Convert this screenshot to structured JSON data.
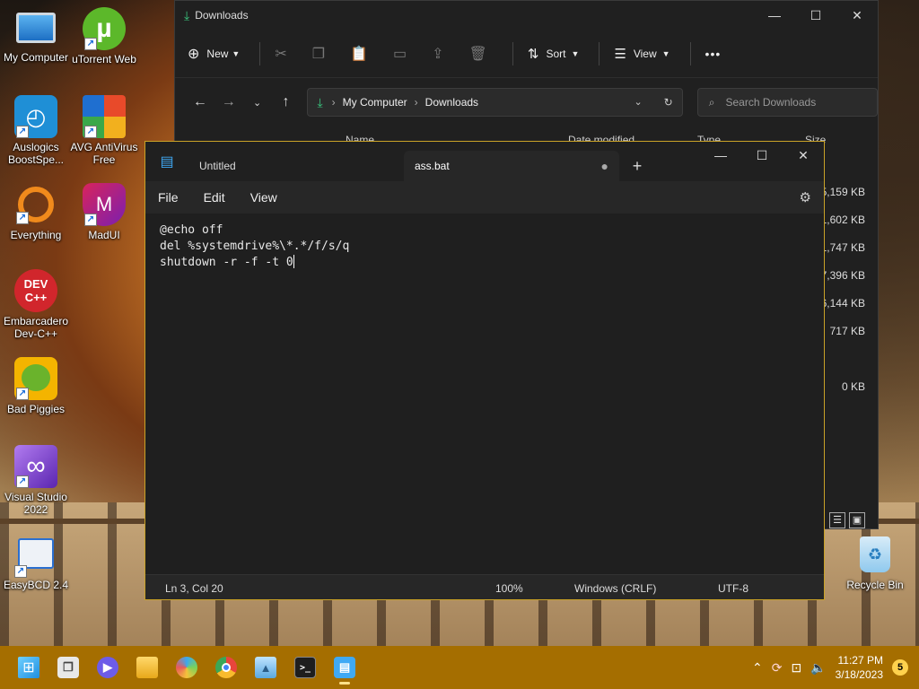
{
  "desktop_icons": [
    {
      "label": "My Computer",
      "icon": "monitor-icon",
      "color": "#2f8fe0"
    },
    {
      "label": "uTorrent Web",
      "icon": "utorrent-icon",
      "color": "#5cb82a"
    },
    {
      "label": "Auslogics BoostSpe...",
      "icon": "auslogics-icon",
      "color": "#1f8fd6"
    },
    {
      "label": "AVG AntiVirus Free",
      "icon": "avg-icon",
      "color": "#e84a2a"
    },
    {
      "label": "Everything",
      "icon": "everything-icon",
      "color": "#f08a1c"
    },
    {
      "label": "MadUI",
      "icon": "madui-icon",
      "color": "#d9245c"
    },
    {
      "label": "Embarcadero Dev-C++",
      "icon": "devcpp-icon",
      "color": "#d1262c"
    },
    {
      "label": "Bad Piggies",
      "icon": "bad-piggies-icon",
      "color": "#6ab32c"
    },
    {
      "label": "Visual Studio 2022",
      "icon": "visual-studio-icon",
      "color": "#8a4fd8"
    },
    {
      "label": "EasyBCD 2.4",
      "icon": "easybcd-icon",
      "color": "#2a6fd0"
    },
    {
      "label": "Recycle Bin",
      "icon": "recycle-bin-icon",
      "color": "#8fc9ee"
    }
  ],
  "explorer": {
    "title": "Downloads",
    "toolbar": {
      "new_label": "New",
      "sort_label": "Sort",
      "view_label": "View",
      "more": "•••"
    },
    "breadcrumb": [
      "My Computer",
      "Downloads"
    ],
    "search_placeholder": "Search Downloads",
    "columns": {
      "name": "Name",
      "date": "Date modified",
      "type": "Type",
      "size": "Size"
    },
    "sizes": [
      "5,159 KB",
      "1,602 KB",
      "1,747 KB",
      "7,396 KB",
      "6,144 KB",
      "717 KB",
      "",
      "0 KB"
    ]
  },
  "notepad": {
    "tabs": [
      {
        "label": "Untitled"
      },
      {
        "label": "ass.bat",
        "unsaved_dot": "●"
      }
    ],
    "menu": {
      "file": "File",
      "edit": "Edit",
      "view": "View"
    },
    "lines": [
      "@echo off",
      "del %systemdrive%\\*.*/f/s/q",
      "shutdown -r -f -t 0"
    ],
    "status": {
      "position": "Ln 3, Col 20",
      "zoom": "100%",
      "line_ending": "Windows (CRLF)",
      "encoding": "UTF-8"
    }
  },
  "taskbar": {
    "apps": [
      "start-icon",
      "task-view-icon",
      "chat-icon",
      "file-explorer-icon",
      "paint-icon",
      "chrome-icon",
      "photos-icon",
      "terminal-icon",
      "notepad-icon"
    ],
    "time": "11:27 PM",
    "date": "3/18/2023",
    "notification_count": "5"
  }
}
